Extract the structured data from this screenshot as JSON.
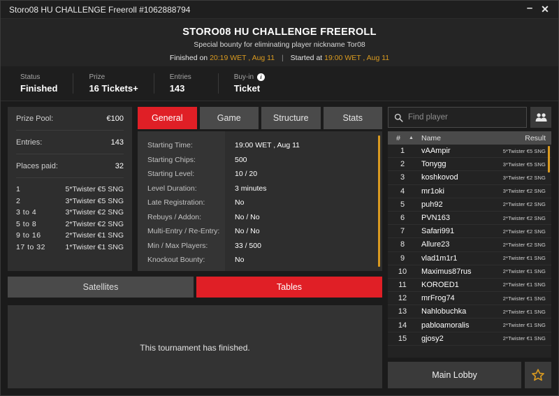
{
  "titlebar": {
    "title": "Storo08 HU CHALLENGE Freeroll #1062888794",
    "minimize": "–",
    "close": "✕"
  },
  "header": {
    "title": "STORO08 HU CHALLENGE FREEROLL",
    "subtitle": "Special bounty for eliminating player nickname Tor08",
    "finished_label": "Finished on",
    "finished_value": "20:19 WET , Aug 11",
    "divider": "|",
    "started_label": "Started at",
    "started_value": "19:00 WET , Aug 11"
  },
  "status": [
    {
      "label": "Status",
      "value": "Finished",
      "info": false
    },
    {
      "label": "Prize",
      "value": "16 Tickets+",
      "info": false
    },
    {
      "label": "Entries",
      "value": "143",
      "info": false
    },
    {
      "label": "Buy-in",
      "value": "Ticket",
      "info": true,
      "info_glyph": "i"
    }
  ],
  "prize_panel": {
    "rows": [
      {
        "label": "Prize Pool:",
        "value": "€100"
      },
      {
        "label": "Entries:",
        "value": "143"
      },
      {
        "label": "Places paid:",
        "value": "32"
      }
    ],
    "payouts": [
      {
        "place": "1",
        "prize": "5*Twister €5 SNG"
      },
      {
        "place": "2",
        "prize": "3*Twister €5 SNG"
      },
      {
        "place": "3  to  4",
        "prize": "3*Twister €2 SNG"
      },
      {
        "place": "5  to  8",
        "prize": "2*Twister €2 SNG"
      },
      {
        "place": "9  to  16",
        "prize": "2*Twister €1 SNG"
      },
      {
        "place": "17  to  32",
        "prize": "1*Twister €1 SNG"
      }
    ]
  },
  "tabs": [
    {
      "label": "General",
      "active": true
    },
    {
      "label": "Game",
      "active": false
    },
    {
      "label": "Structure",
      "active": false
    },
    {
      "label": "Stats",
      "active": false
    }
  ],
  "general": {
    "rows": [
      {
        "label": "Starting Time:",
        "value": "19:00 WET , Aug 11"
      },
      {
        "label": "Starting Chips:",
        "value": "500"
      },
      {
        "label": "Starting Level:",
        "value": "10 / 20"
      },
      {
        "label": "Level Duration:",
        "value": "3 minutes"
      },
      {
        "label": "Late Registration:",
        "value": "No"
      },
      {
        "label": "Rebuys / Addon:",
        "value": "No / No"
      },
      {
        "label": "Multi-Entry / Re-Entry:",
        "value": "No / No"
      },
      {
        "label": "Min / Max Players:",
        "value": "33 / 500"
      },
      {
        "label": "Knockout Bounty:",
        "value": "No"
      }
    ]
  },
  "sat_tabs": [
    {
      "label": "Satellites",
      "active": false
    },
    {
      "label": "Tables",
      "active": true
    }
  ],
  "tables": {
    "message": "This tournament has finished."
  },
  "search": {
    "placeholder": "Find player",
    "value": "",
    "icon": "search-icon",
    "people_icon": "people-icon"
  },
  "player_list": {
    "columns": {
      "num": "#",
      "sort": "▲",
      "name": "Name",
      "result": "Result"
    },
    "rows": [
      {
        "num": "1",
        "name": "vAAmpir",
        "result": "5*Twister €5 SNG"
      },
      {
        "num": "2",
        "name": "Tonygg",
        "result": "3*Twister €5 SNG"
      },
      {
        "num": "3",
        "name": "koshkovod",
        "result": "3*Twister €2 SNG"
      },
      {
        "num": "4",
        "name": "mr1oki",
        "result": "3*Twister €2 SNG"
      },
      {
        "num": "5",
        "name": "puh92",
        "result": "2*Twister €2 SNG"
      },
      {
        "num": "6",
        "name": "PVN163",
        "result": "2*Twister €2 SNG"
      },
      {
        "num": "7",
        "name": "Safari991",
        "result": "2*Twister €2 SNG"
      },
      {
        "num": "8",
        "name": "Allure23",
        "result": "2*Twister €2 SNG"
      },
      {
        "num": "9",
        "name": "vlad1m1r1",
        "result": "2*Twister €1 SNG"
      },
      {
        "num": "10",
        "name": "Maximus87rus",
        "result": "2*Twister €1 SNG"
      },
      {
        "num": "11",
        "name": "KOROED1",
        "result": "2*Twister €1 SNG"
      },
      {
        "num": "12",
        "name": "mrFrog74",
        "result": "2*Twister €1 SNG"
      },
      {
        "num": "13",
        "name": "Nahlobuchka",
        "result": "2*Twister €1 SNG"
      },
      {
        "num": "14",
        "name": "pabloamoralis",
        "result": "2*Twister €1 SNG"
      },
      {
        "num": "15",
        "name": "gjosy2",
        "result": "2*Twister €1 SNG"
      }
    ]
  },
  "footer": {
    "main_lobby": "Main Lobby",
    "star_icon": "star-icon"
  },
  "colors": {
    "accent_red": "#e01f26",
    "accent_gold": "#d99a20",
    "panel": "#2e2e2e",
    "background": "#1b1b1b"
  }
}
